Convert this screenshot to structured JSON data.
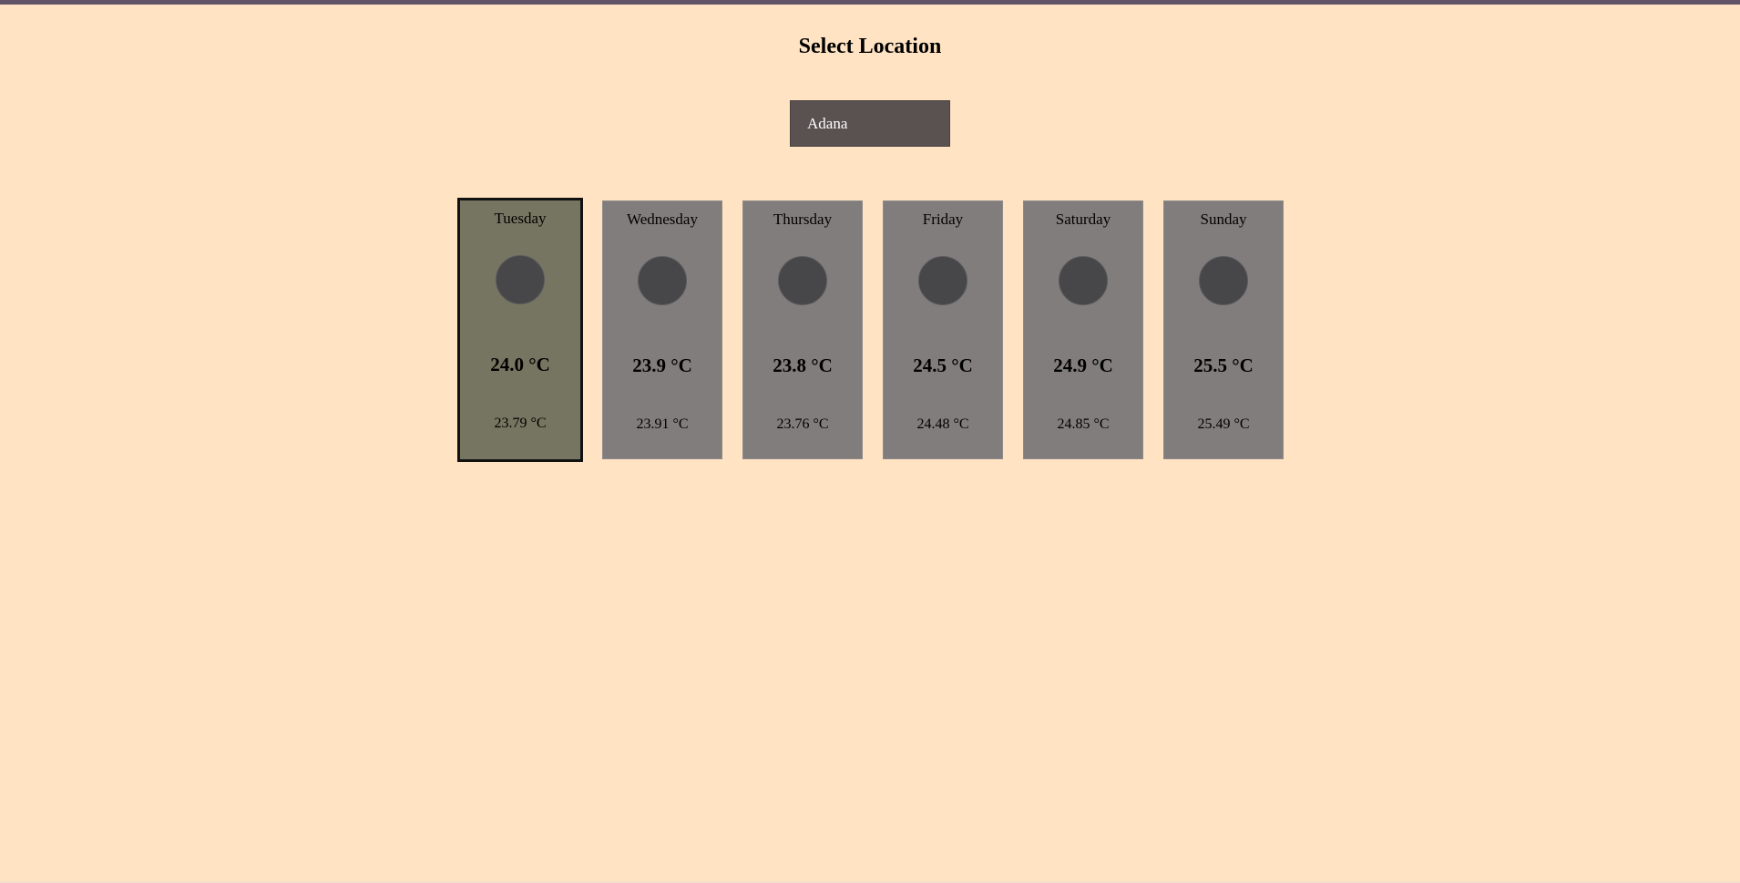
{
  "header": {
    "title": "Select Location"
  },
  "location": {
    "selected": "Adana"
  },
  "forecast": [
    {
      "day": "Tuesday",
      "temp": "24.0 °C",
      "sub": "23.79 °C",
      "selected": true
    },
    {
      "day": "Wednesday",
      "temp": "23.9 °C",
      "sub": "23.91 °C",
      "selected": false
    },
    {
      "day": "Thursday",
      "temp": "23.8 °C",
      "sub": "23.76 °C",
      "selected": false
    },
    {
      "day": "Friday",
      "temp": "24.5 °C",
      "sub": "24.48 °C",
      "selected": false
    },
    {
      "day": "Saturday",
      "temp": "24.9 °C",
      "sub": "24.85 °C",
      "selected": false
    },
    {
      "day": "Sunday",
      "temp": "25.5 °C",
      "sub": "25.49 °C",
      "selected": false
    }
  ],
  "icons": {
    "weather": "weather-icon"
  },
  "colors": {
    "background": "#ffe3c2",
    "top_bar": "#5f5468",
    "select_bg": "#5a5151",
    "card_bg": "#827d7d",
    "card_selected_bg": "#767561",
    "icon_fill": "#474649"
  }
}
